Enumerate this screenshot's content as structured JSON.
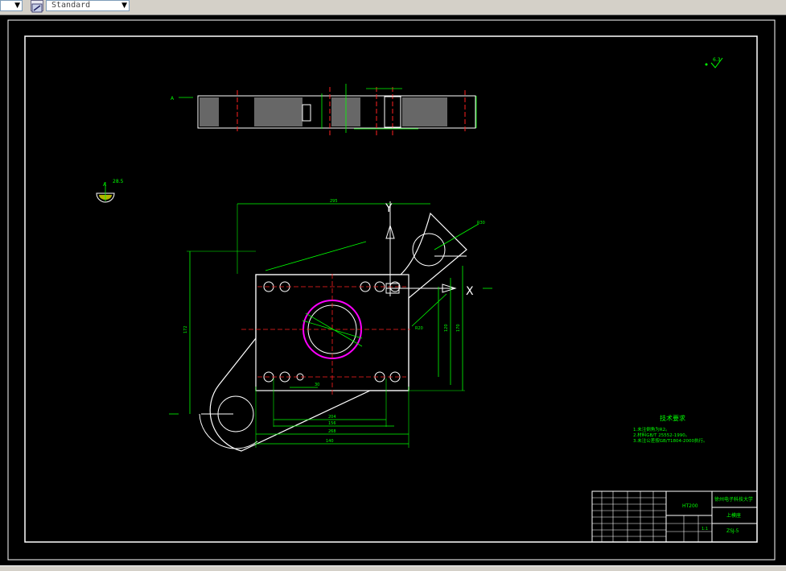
{
  "toolbar": {
    "left_dropdown_value": "",
    "text_style_value": "Standard",
    "icons": [
      "dropdown-arrow-icon",
      "text-style-icon"
    ]
  },
  "drawing": {
    "view_marker_a": "A",
    "section_note_a": "A",
    "section_note_angle": "28.5",
    "y_axis": "Y",
    "x_axis": "X",
    "surface_finish": "6.3",
    "dims": {
      "top_width": "295",
      "left_height": "172",
      "bottom_width": "140",
      "inner_width_1": "204",
      "inner_width_2": "156",
      "inner_width_3": "268",
      "right_1": "120",
      "right_2": "170",
      "small_1": "30",
      "r_upper": "R30",
      "r_mid": "R20"
    },
    "tech_title": "技术要求",
    "tech_lines": [
      "1.未注倒角为R2。",
      "2.材料GB/T 25552-1990。",
      "3.未注公差按GB/T1804-2000执行。"
    ],
    "title_block": {
      "part_label": "HT200",
      "school": "徐州电子科技大学",
      "part_name": "上模座",
      "drawing_no": "ZSJ-5",
      "scale": "1:1"
    },
    "colors": {
      "bg": "#000000",
      "border": "#ffffff",
      "geometry": "#ffffff",
      "dims": "#00ff00",
      "center": "#ff2020",
      "circle": "#ff00ff",
      "text": "#00ff00"
    }
  }
}
